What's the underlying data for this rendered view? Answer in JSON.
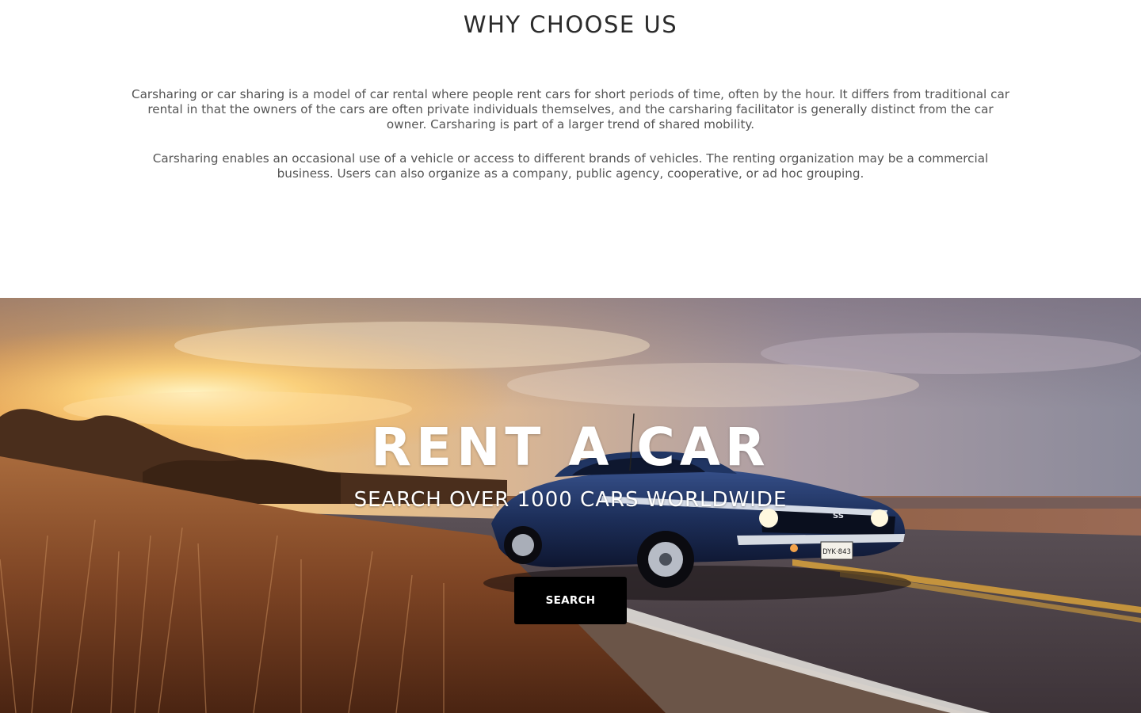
{
  "why_section": {
    "title": "WHY CHOOSE US",
    "paragraphs": [
      "Carsharing or car sharing is a model of car rental where people rent cars for short periods of time, often by the hour. It differs from traditional car rental in that the owners of the cars are often private individuals themselves, and the carsharing facilitator is generally distinct from the car owner. Carsharing is part of a larger trend of shared mobility.",
      "Carsharing enables an occasional use of a vehicle or access to different brands of vehicles. The renting organization may be a commercial business. Users can also organize as a company, public agency, cooperative, or ad hoc grouping."
    ]
  },
  "hero": {
    "title": "RENT A CAR",
    "subtitle": "SEARCH OVER 1000 CARS WORLDWIDE",
    "search_button_label": "SEARCH",
    "license_plate": "DYK·843",
    "badge": "SS"
  },
  "colors": {
    "page_background": "#ffffff",
    "heading_text": "#2b2b2b",
    "body_text": "#555555",
    "button_background": "#000000",
    "button_text": "#ffffff",
    "sky_warm": "#f2b35a",
    "sky_cool": "#8d8ea0",
    "car_body": "#1d2f5a"
  }
}
